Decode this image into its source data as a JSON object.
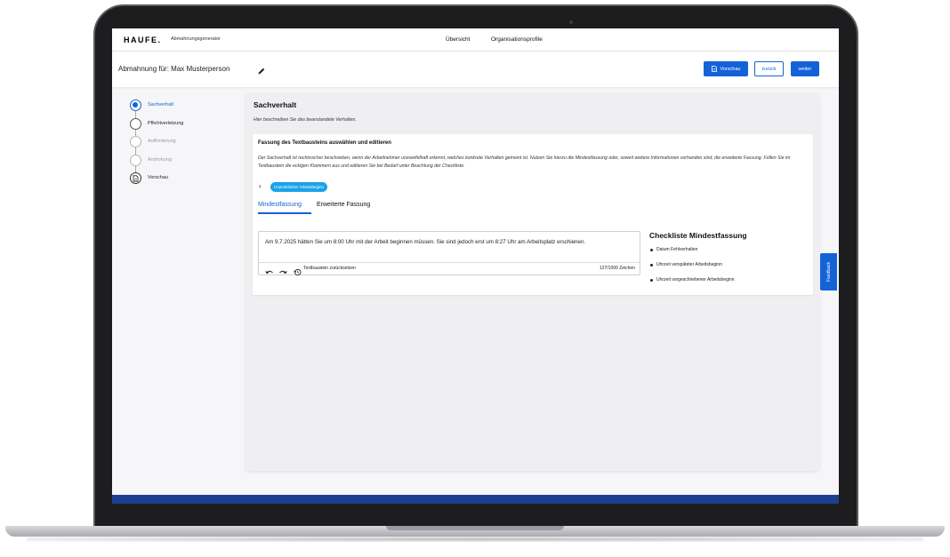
{
  "top_nav": {
    "logo": "HAUFE.",
    "app_name": "Abmahnungsgenerator",
    "links": [
      "Übersicht",
      "Organisationsprofile"
    ]
  },
  "header": {
    "title": "Abmahnung für: Max Musterperson",
    "preview_label": "Vorschau",
    "back_label": "zurück",
    "next_label": "weiter"
  },
  "stepper": {
    "steps": [
      {
        "label": "Sachverhalt",
        "state": "active"
      },
      {
        "label": "Pflichtverletzung",
        "state": "default"
      },
      {
        "label": "Aufforderung",
        "state": "disabled"
      },
      {
        "label": "Androhung",
        "state": "disabled"
      },
      {
        "label": "Vorschau",
        "state": "document"
      }
    ]
  },
  "main": {
    "title": "Sachverhalt",
    "description": "Hier beschreiben Sie das beanstandete Verhalten.",
    "card": {
      "title": "Fassung des Textbausteins auswählen und editieren",
      "description": "Der Sachverhalt ist rechtssicher beschrieben, wenn der Arbeitnehmer unzweifelhaft erkennt, welches konkrete Verhalten gemeint ist. Nutzen Sie hierzu die Mindestfassung oder, soweit weitere Informationen vorhanden sind, die erweiterte Fassung. Füllen Sie im Textbaustein die eckigen Klammern aus und editieren Sie bei Bedarf unter Beachtung der Checkliste.",
      "tag": "Unpünktlicher Arbeitsbeginn",
      "tabs": [
        "Mindestfassung",
        "Erweiterte Fassung"
      ],
      "editor": {
        "text": "Am 9.7.2025 hätten Sie um 8:00 Uhr mit der Arbeit beginnen müssen. Sie sind jedoch erst um 8:27 Uhr am Arbeitsplatz erschienen.",
        "reset_label": "Textbaustein zurücksetzen",
        "char_count": "127/1000 Zeichen"
      },
      "checklist": {
        "title": "Checkliste Mindestfassung",
        "items": [
          "Datum Fehlverhalten",
          "Uhrzeit verspäteter Arbeitsbeginn",
          "Uhrzeit vorgeschriebener Arbeitsbeginn"
        ]
      }
    }
  },
  "feedback_label": "Feedback",
  "colors": {
    "accent": "#1462d8",
    "tag": "#1aa3e8",
    "footer": "#1d3f8f"
  }
}
